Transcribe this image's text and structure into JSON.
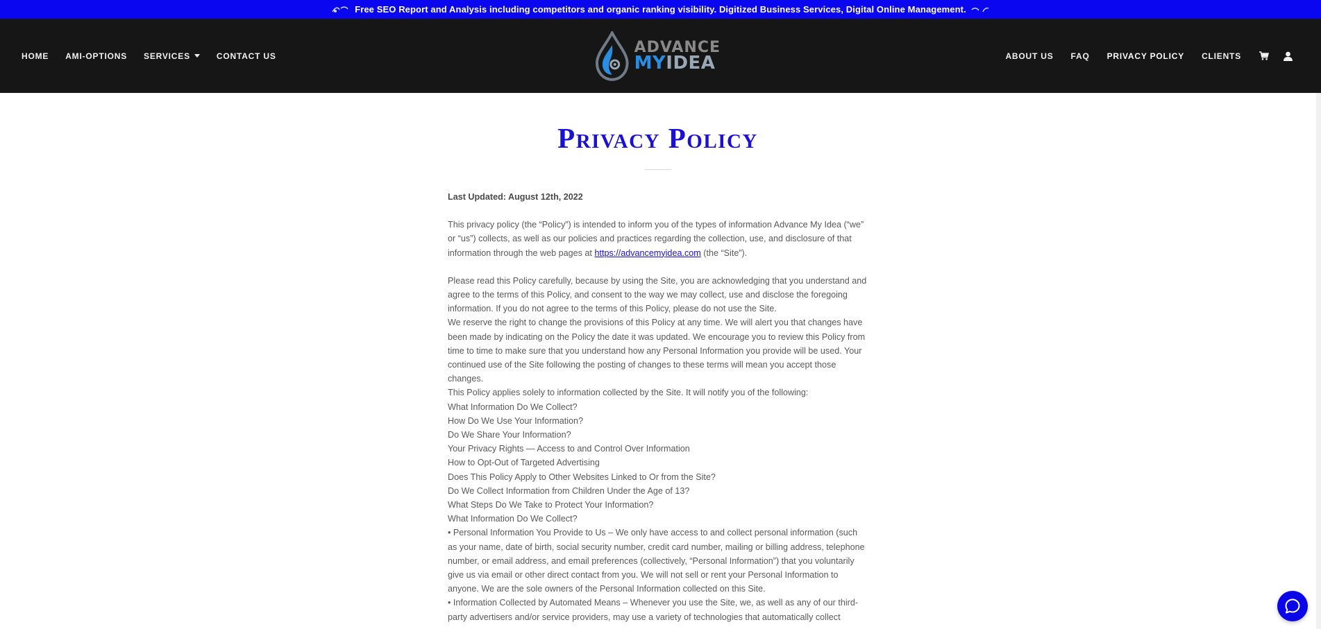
{
  "announcement": {
    "text": "Free SEO Report and Analysis including competitors and organic ranking visibility. Digitized Business Services, Digital Online Management."
  },
  "nav_left": [
    {
      "label": "HOME",
      "icon": null
    },
    {
      "label": "AMI-OPTIONS",
      "icon": null
    },
    {
      "label": "SERVICES",
      "icon": "caret-down-icon"
    },
    {
      "label": "CONTACT US",
      "icon": null
    }
  ],
  "logo": {
    "line1": "ADVANCE",
    "line2a": "MY",
    "line2b": "IDEA"
  },
  "nav_right": [
    {
      "label": "ABOUT US",
      "active": false
    },
    {
      "label": "FAQ",
      "active": false
    },
    {
      "label": "PRIVACY POLICY",
      "active": true
    },
    {
      "label": "CLIENTS",
      "active": false
    }
  ],
  "header_icons": [
    "cart-icon",
    "user-icon"
  ],
  "page": {
    "title": "Privacy Policy",
    "last_updated": "Last Updated: August 12th, 2022",
    "intro_before_link": "This privacy policy (the “Policy”) is intended to inform you of the types of information Advance My Idea (“we” or “us”) collects, as well as our policies and practices regarding the collection, use, and disclosure of that information through the web pages at ",
    "intro_link": "https://advancemyidea.com",
    "intro_after_link": " (the “Site”).",
    "para_read": "Please read this Policy carefully, because by using the Site, you are acknowledging that you understand and agree to the terms of this Policy, and consent to the way we may collect, use and disclose the foregoing information. If you do not agree to the terms of this Policy, please do not use the Site.",
    "para_reserve": "We reserve the right to change the provisions of this Policy at any time. We will alert you that changes have been made by indicating on the Policy the date it was updated. We encourage you to review this Policy from time to time to make sure that you understand how any Personal Information you provide will be used. Your continued use of the Site following the posting of changes to these terms will mean you accept those changes.",
    "para_applies": "This Policy applies solely to information collected by the Site. It will notify you of the following:",
    "toc": [
      "What Information Do We Collect?",
      "How Do We Use Your Information?",
      "Do We Share Your Information?",
      "Your Privacy Rights — Access to and Control Over Information",
      "How to Opt-Out of Targeted Advertising",
      "Does This Policy Apply to Other Websites Linked to Or from the Site?",
      "Do We Collect Information from Children Under the Age of 13?",
      "What Steps Do We Take to Protect Your Information?"
    ],
    "section_heading": "What Information Do We Collect?",
    "bullet_personal": "• Personal Information You Provide to Us – We only have access to and collect personal information (such as your name, date of birth, social security number, credit card number, mailing or billing address, telephone number, or email address, and email preferences (collectively, “Personal Information”) that you voluntarily give us via email or other direct contact from you. We will not sell or rent your Personal Information to anyone. We are the sole owners of the Personal Information collected on this Site.",
    "bullet_automated": "• Information Collected by Automated Means – Whenever you use the Site, we, as well as any of our third-party advertisers and/or service providers, may use a variety of technologies that automatically collect"
  },
  "chat": {
    "icon": "chat-icon"
  },
  "colors": {
    "announce_bg": "#0a06f0",
    "header_bg": "#161616",
    "accent": "#1a10d8"
  }
}
